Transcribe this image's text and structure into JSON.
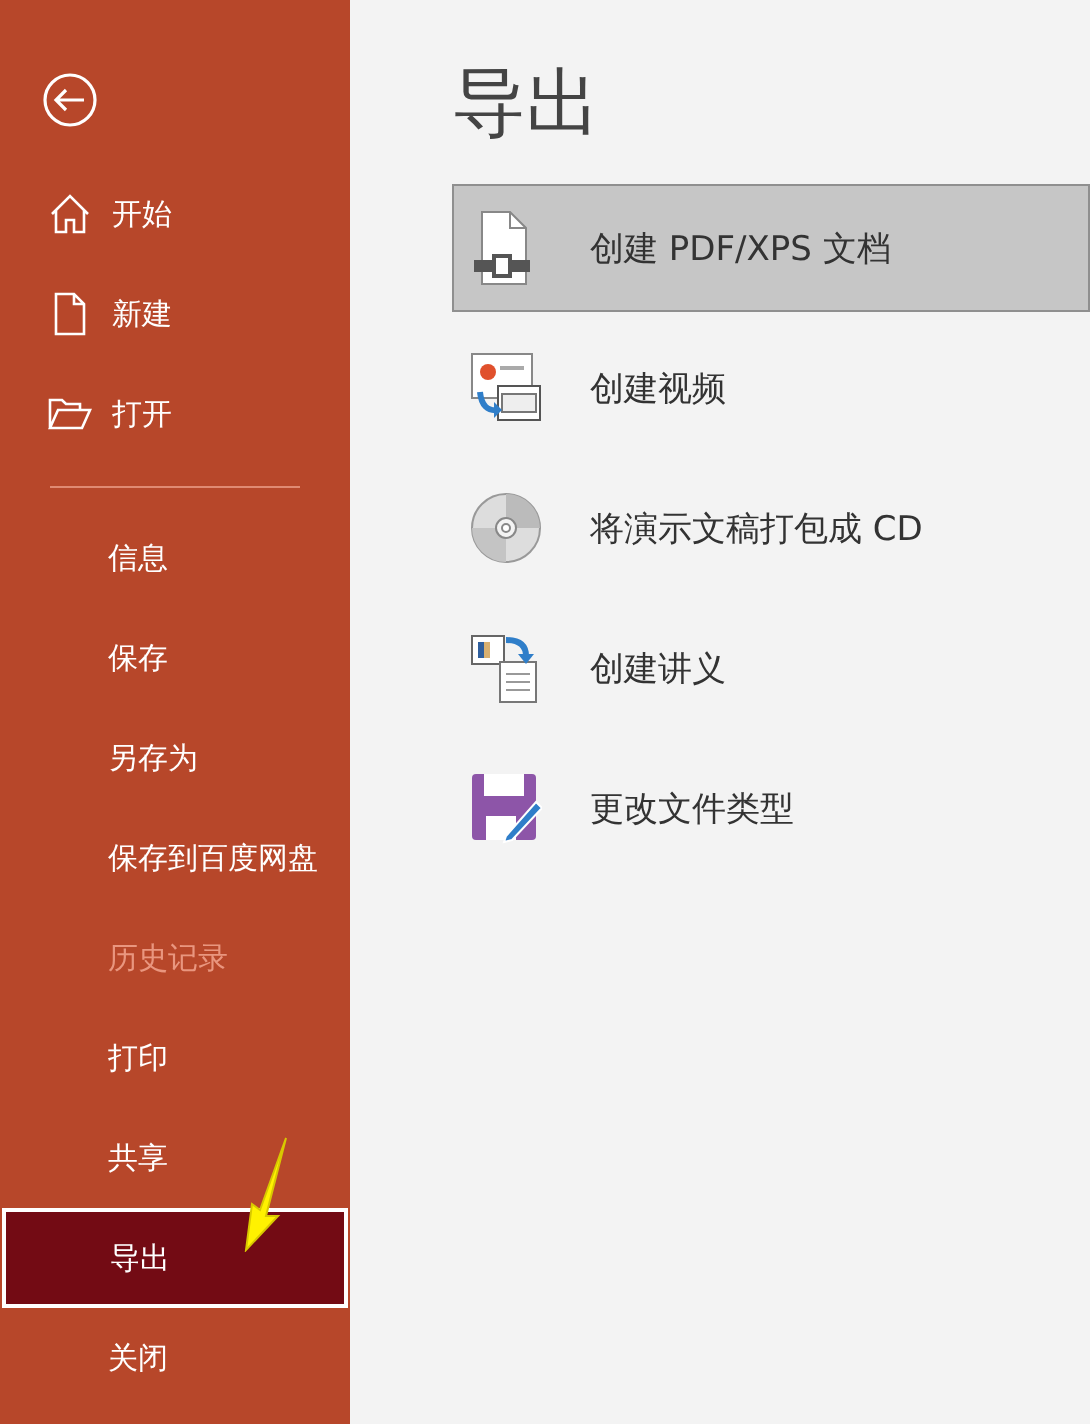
{
  "sidebar": {
    "top_items": [
      {
        "label": "开始",
        "selected": false
      },
      {
        "label": "新建",
        "selected": false
      },
      {
        "label": "打开",
        "selected": false
      }
    ],
    "items": [
      {
        "label": "信息",
        "selected": false,
        "disabled": false
      },
      {
        "label": "保存",
        "selected": false,
        "disabled": false
      },
      {
        "label": "另存为",
        "selected": false,
        "disabled": false
      },
      {
        "label": "保存到百度网盘",
        "selected": false,
        "disabled": false
      },
      {
        "label": "历史记录",
        "selected": false,
        "disabled": true
      },
      {
        "label": "打印",
        "selected": false,
        "disabled": false
      },
      {
        "label": "共享",
        "selected": false,
        "disabled": false
      },
      {
        "label": "导出",
        "selected": true,
        "disabled": false
      },
      {
        "label": "关闭",
        "selected": false,
        "disabled": false
      }
    ]
  },
  "main": {
    "title": "导出",
    "options": [
      {
        "label": "创建 PDF/XPS 文档",
        "selected": true
      },
      {
        "label": "创建视频",
        "selected": false
      },
      {
        "label": "将演示文稿打包成 CD",
        "selected": false
      },
      {
        "label": "创建讲义",
        "selected": false
      },
      {
        "label": "更改文件类型",
        "selected": false
      }
    ]
  }
}
